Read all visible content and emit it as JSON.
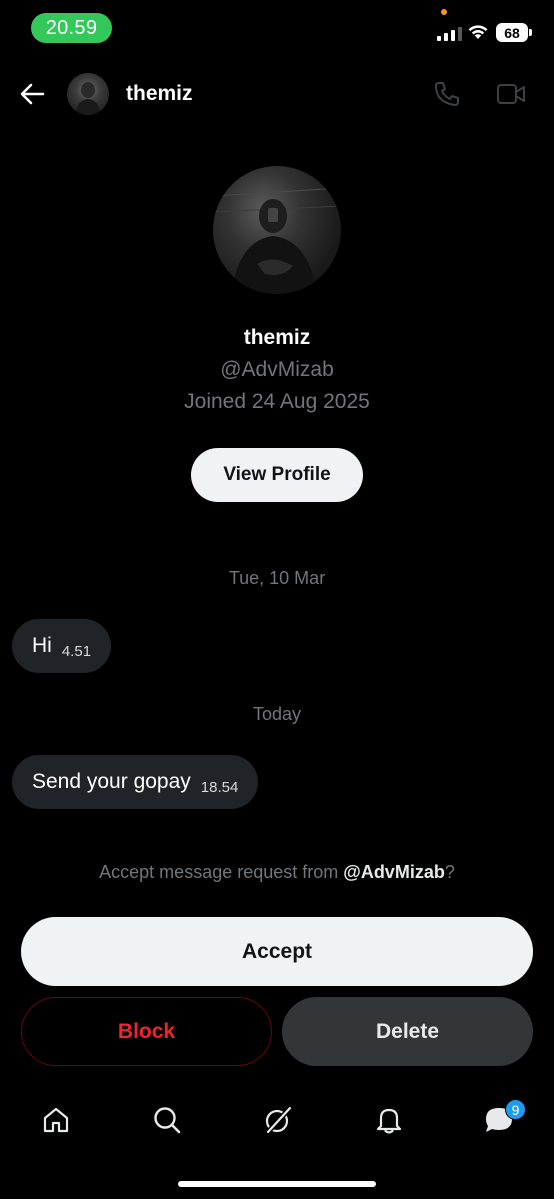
{
  "status_bar": {
    "time": "20.59",
    "battery": "68"
  },
  "header": {
    "name": "themiz",
    "icons": [
      "back-arrow-icon",
      "phone-icon",
      "video-icon"
    ]
  },
  "profile": {
    "name": "themiz",
    "handle": "@AdvMizab",
    "joined": "Joined 24 Aug 2025",
    "view_profile_label": "View Profile"
  },
  "conversation": [
    {
      "date": "Tue, 10 Mar",
      "messages": [
        {
          "text": "Hi",
          "time": "4.51"
        }
      ]
    },
    {
      "date": "Today",
      "messages": [
        {
          "text": "Send your gopay",
          "time": "18.54"
        }
      ]
    }
  ],
  "request": {
    "prefix": "Accept message request from ",
    "handle": "@AdvMizab",
    "suffix": "?",
    "accept_label": "Accept",
    "block_label": "Block",
    "delete_label": "Delete"
  },
  "bottom_nav": {
    "items": [
      "home-icon",
      "search-icon",
      "grok-icon",
      "notifications-icon",
      "messages-icon"
    ],
    "messages_badge": "9"
  },
  "colors": {
    "background": "#000000",
    "accent_blue": "#1d9bf0",
    "danger_red": "#f4212e",
    "status_green": "#34c759"
  }
}
